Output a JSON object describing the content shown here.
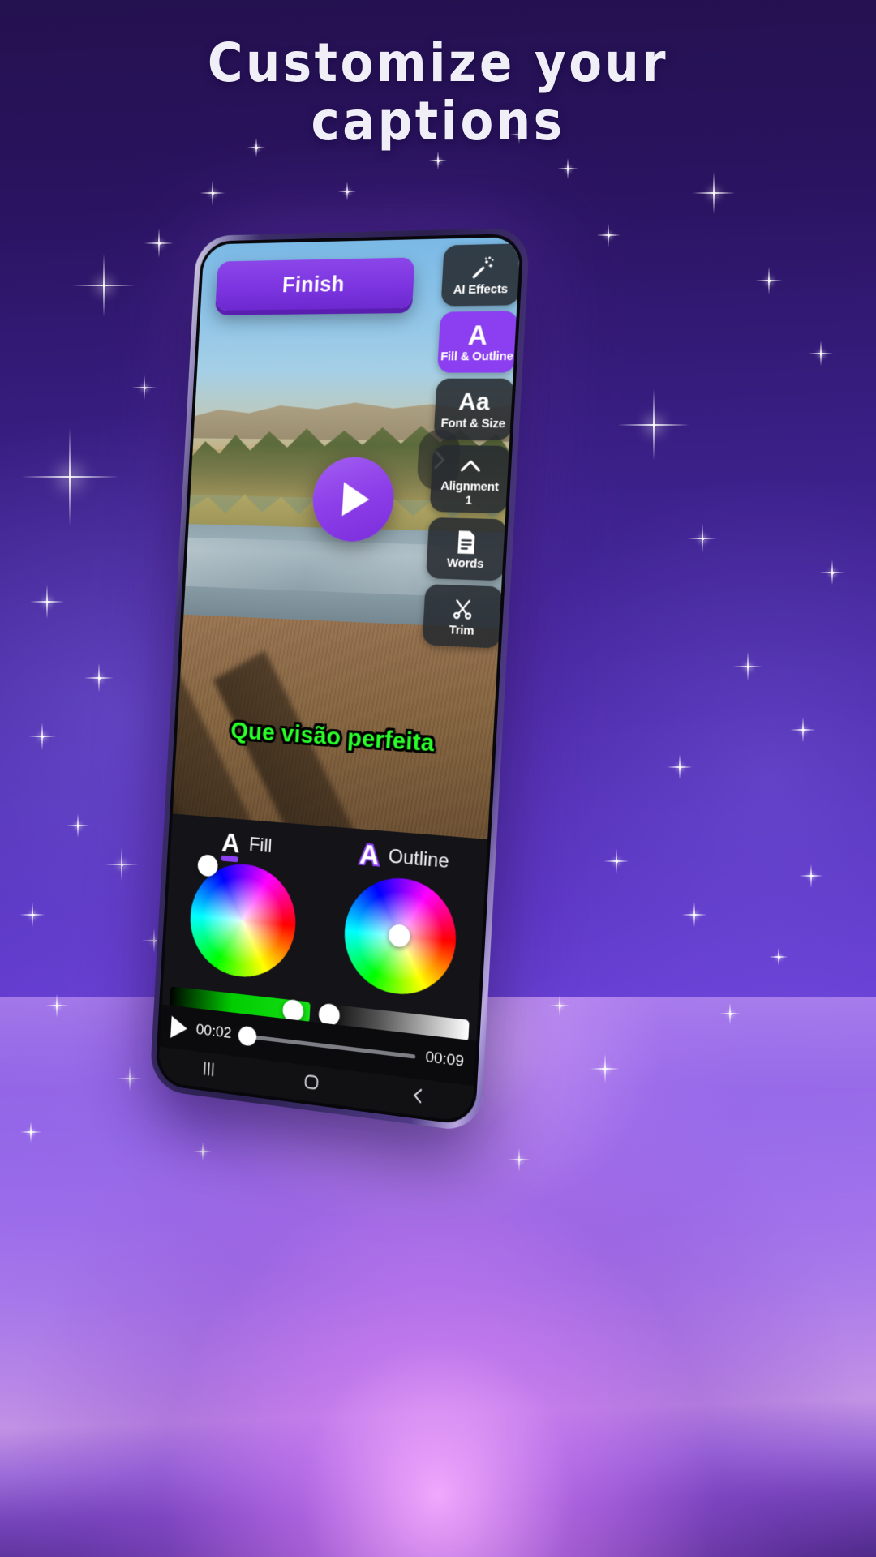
{
  "headline": {
    "line1": "Customize your",
    "line2": "captions"
  },
  "phone": {
    "editor": {
      "finish_button": "Finish",
      "play_button_icon": "play-icon",
      "next_arrow_icon": "chevron-right-icon",
      "caption_text": "Que visão perfeita",
      "caption_color": "#2aff2a",
      "caption_outline_color": "#000000",
      "toolbar": [
        {
          "icon": "magic-wand-icon",
          "glyph": "✨",
          "label": "AI Effects",
          "sub": "",
          "active": false
        },
        {
          "icon": "letter-a-icon",
          "glyph": "A",
          "label": "Fill & Outline",
          "sub": "",
          "active": true
        },
        {
          "icon": "font-size-icon",
          "glyph": "Aa",
          "label": "Font & Size",
          "sub": "",
          "active": false
        },
        {
          "icon": "chevron-up-icon",
          "glyph": "^",
          "label": "Alignment",
          "sub": "1",
          "active": false
        },
        {
          "icon": "document-lines-icon",
          "glyph": "▤",
          "label": "Words",
          "sub": "",
          "active": false
        },
        {
          "icon": "scissors-icon",
          "glyph": "✂",
          "label": "Trim",
          "sub": "",
          "active": false
        }
      ]
    },
    "color_panel": {
      "fill": {
        "letter": "A",
        "label": "Fill",
        "accent": "#8b3ff0",
        "selected_color": "#2aff2a"
      },
      "outline": {
        "letter": "A",
        "label": "Outline",
        "accent": "#8b3ff0",
        "selected_color": "#ffffff"
      }
    },
    "timeline": {
      "play_icon": "play-icon",
      "current_time": "00:02",
      "total_time": "00:09",
      "progress_percent": 4
    },
    "navbar": {
      "recents_icon": "recents-icon",
      "home_icon": "home-icon",
      "back_icon": "back-icon"
    }
  },
  "theme": {
    "accent_purple": "#8b3ff0",
    "background_top": "#24114f",
    "background_glow": "#c79ae6"
  }
}
